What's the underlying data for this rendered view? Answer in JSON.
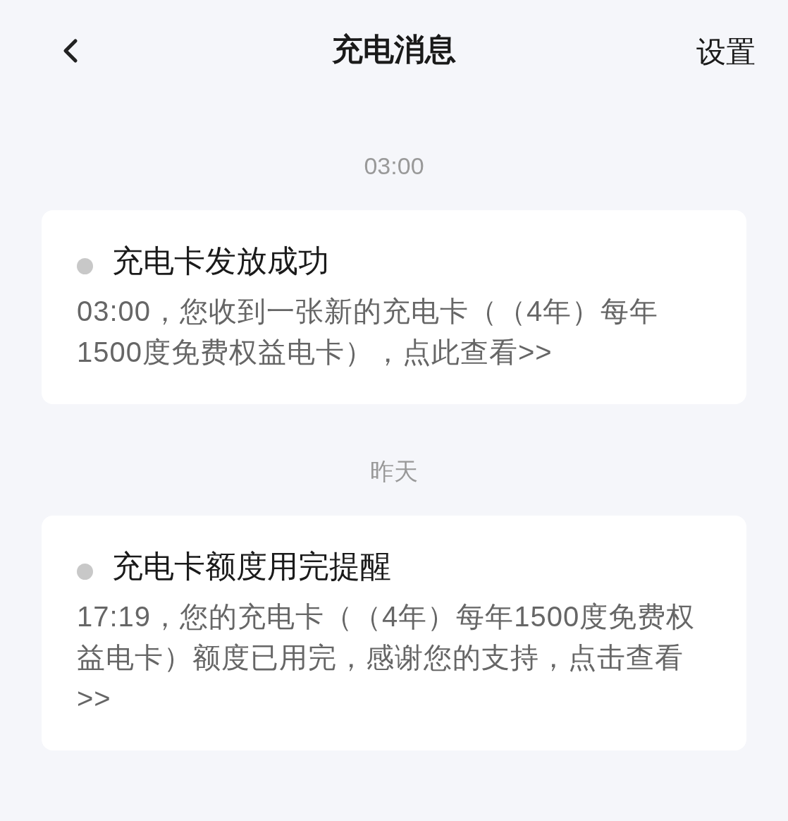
{
  "header": {
    "title": "充电消息",
    "action": "设置"
  },
  "groups": [
    {
      "time": "03:00",
      "message": {
        "title": "充电卡发放成功",
        "unread": false,
        "body": "03:00，您收到一张新的充电卡（（4年）每年1500度免费权益电卡），点此查看>>"
      }
    },
    {
      "time": "昨天",
      "message": {
        "title": "充电卡额度用完提醒",
        "unread": false,
        "body": "17:19，您的充电卡（（4年）每年1500度免费权益电卡）额度已用完，感谢您的支持，点击查看>>"
      }
    }
  ]
}
